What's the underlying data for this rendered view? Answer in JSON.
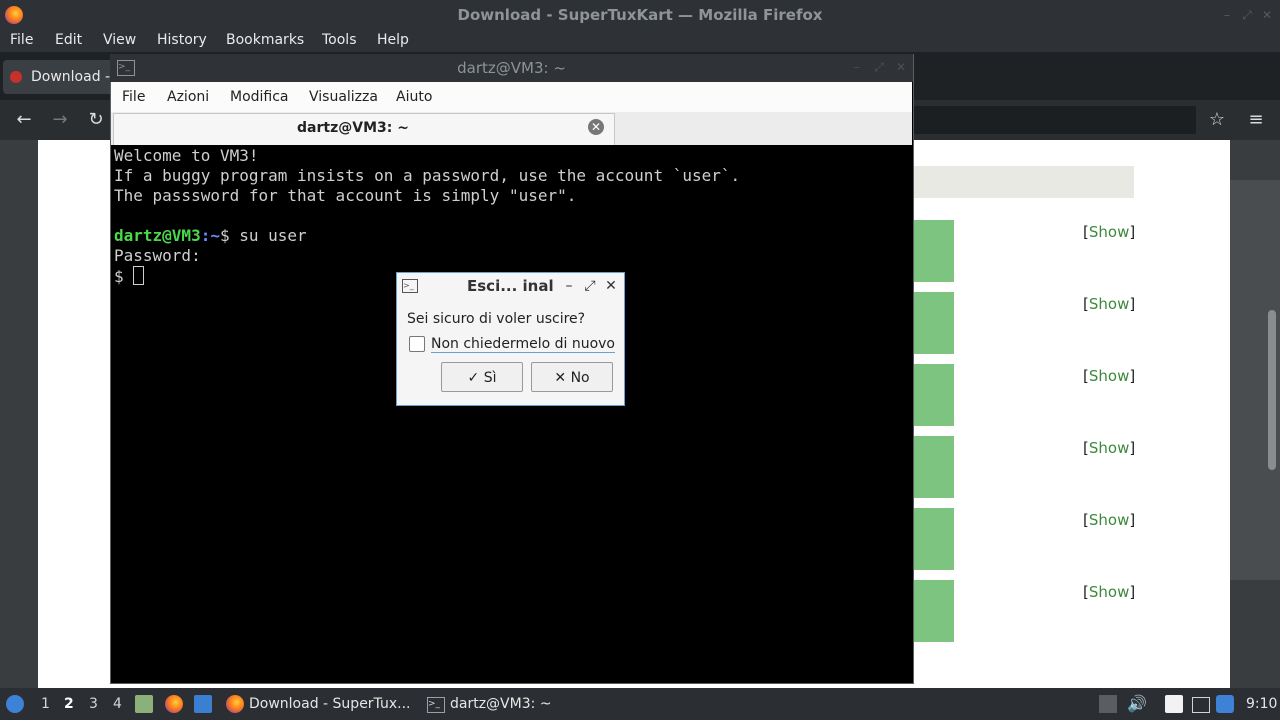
{
  "firefox": {
    "window_title": "Download - SuperTuxKart — Mozilla Firefox",
    "menu": [
      "File",
      "Edit",
      "View",
      "History",
      "Bookmarks",
      "Tools",
      "Help"
    ],
    "tab_label": "Download -",
    "show_links": [
      "Show",
      "Show",
      "Show",
      "Show",
      "Show",
      "Show"
    ]
  },
  "terminal": {
    "window_title": "dartz@VM3: ~",
    "menu": [
      "File",
      "Azioni",
      "Modifica",
      "Visualizza",
      "Aiuto"
    ],
    "tab_label": "dartz@VM3: ~",
    "lines": {
      "l1": "Welcome to VM3!",
      "l2": "If a buggy program insists on a password, use the account `user`.",
      "l3": "The passsword for that account is simply \"user\".",
      "prompt_user": "dartz@VM3",
      "prompt_path": ":~",
      "prompt_cmd": "$ su user",
      "l5": "Password:",
      "l6": "$ "
    }
  },
  "dialog": {
    "title": "Esci... inal",
    "message": "Sei sicuro di voler uscire?",
    "checkbox_label": "Non chiedermelo di nuovo",
    "yes_label": "✓ Sì",
    "no_label": "✕ No"
  },
  "taskbar": {
    "workspaces": [
      "1",
      "2",
      "3",
      "4"
    ],
    "tasks": [
      "Download - SuperTux...",
      "dartz@VM3: ~"
    ],
    "clock": "9:10"
  },
  "colors": {
    "accent": "#6aa0d6",
    "prompt_user": "#4ad94a",
    "prompt_path": "#6c8cff",
    "green_box": "#7cc47f"
  }
}
